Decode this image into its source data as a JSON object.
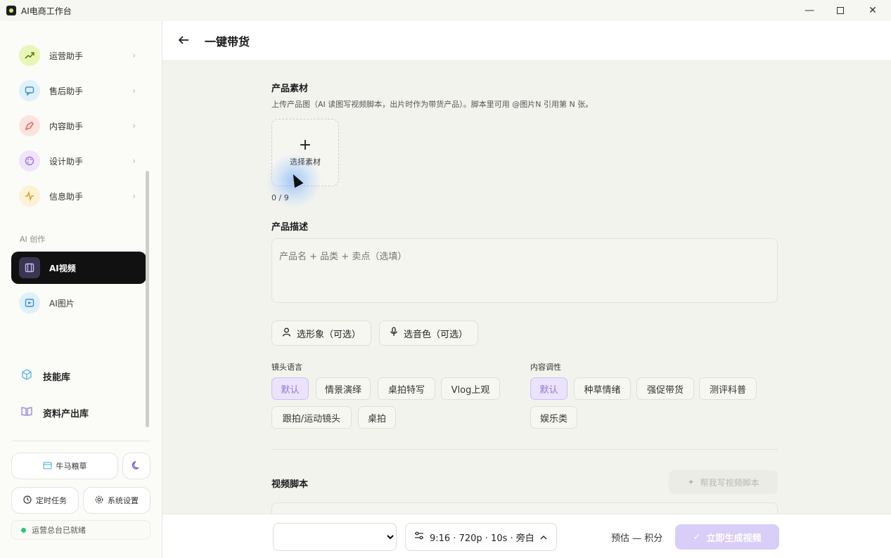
{
  "window": {
    "title": "AI电商工作台"
  },
  "sidebar": {
    "assistants": [
      {
        "label": "运营助手",
        "icon": "trend-up-icon",
        "bg": "#e8f7b6",
        "fg": "#5a7d12"
      },
      {
        "label": "售后助手",
        "icon": "chat-bubble-icon",
        "bg": "#dff0fb",
        "fg": "#3a8fd0"
      },
      {
        "label": "内容助手",
        "icon": "pen-nib-icon",
        "bg": "#fde3df",
        "fg": "#e0604e"
      },
      {
        "label": "设计助手",
        "icon": "palette-icon",
        "bg": "#efe5fb",
        "fg": "#9b74d9"
      },
      {
        "label": "信息助手",
        "icon": "pulse-icon",
        "bg": "#fdf1d6",
        "fg": "#d6a02a"
      }
    ],
    "section_label": "AI 创作",
    "creation": [
      {
        "label": "AI视频",
        "icon": "film-icon"
      },
      {
        "label": "AI图片",
        "icon": "image-icon"
      }
    ],
    "libraries": [
      {
        "label": "技能库",
        "icon": "cube-icon"
      },
      {
        "label": "资料产出库",
        "icon": "book-open-icon"
      }
    ],
    "draft_button": "牛马粮草",
    "scheduled_button": "定时任务",
    "settings_button": "系统设置",
    "status_text": "运营总台已就绪"
  },
  "header": {
    "title": "一键带货"
  },
  "main": {
    "material": {
      "title": "产品素材",
      "subtitle": "上传产品图（AI 读图写视频脚本，出片时作为带货产品）。脚本里可用 @图片N 引用第 N 张。",
      "upload_label": "选择素材",
      "count": "0 / 9"
    },
    "description": {
      "title": "产品描述",
      "placeholder": "产品名 + 品类 + 卖点（选填）"
    },
    "options": {
      "avatar_button": "选形象（可选）",
      "voice_button": "选音色（可选）"
    },
    "shot_language": {
      "label": "镜头语言",
      "chips": [
        "默认",
        "情景演绎",
        "桌拍特写",
        "Vlog上观",
        "跟拍/运动镜头",
        "桌拍"
      ],
      "selected": 0
    },
    "content_style": {
      "label": "内容调性",
      "chips": [
        "默认",
        "种草情绪",
        "强促带货",
        "测评科普",
        "娱乐类"
      ],
      "selected": 0
    },
    "script": {
      "title": "视频脚本",
      "ai_button": "帮我写视频脚本"
    }
  },
  "bottom": {
    "params": "9:16 · 720p · 10s · 旁白",
    "estimate": "预估 — 积分",
    "generate_button": "立即生成视频"
  }
}
